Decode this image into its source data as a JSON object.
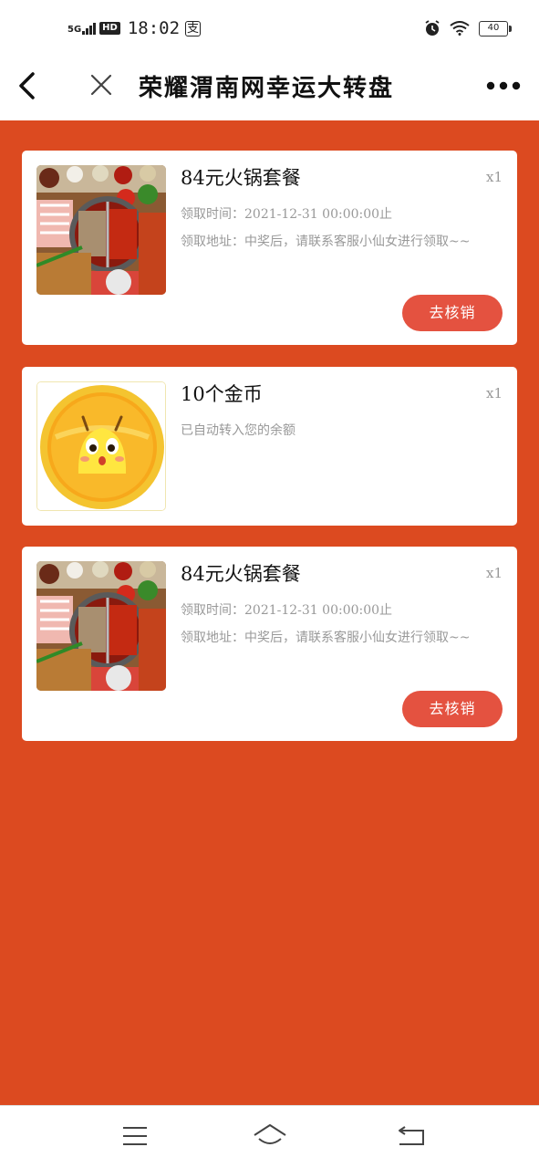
{
  "status_bar": {
    "network": "5G",
    "hd": "HD",
    "time": "18:02",
    "pay_badge": "支",
    "battery": "40"
  },
  "nav": {
    "title": "荣耀渭南网幸运大转盘",
    "back_icon": "chevron-left-icon",
    "close_icon": "close-icon",
    "more_icon": "more-dots-icon"
  },
  "prizes": [
    {
      "title": "84元火锅套餐",
      "qty": "x1",
      "time_line": "领取时间：2021-12-31 00:00:00止",
      "address_line": "领取地址：中奖后，请联系客服小仙女进行领取~~",
      "button": "去核销",
      "image": "hotpot-photo"
    },
    {
      "title": "10个金币",
      "qty": "x1",
      "note": "已自动转入您的余额",
      "image": "gold-coin-mascot"
    },
    {
      "title": "84元火锅套餐",
      "qty": "x1",
      "time_line": "领取时间：2021-12-31 00:00:00止",
      "address_line": "领取地址：中奖后，请联系客服小仙女进行领取~~",
      "button": "去核销",
      "image": "hotpot-photo"
    }
  ],
  "colors": {
    "background": "#dc4a20",
    "button": "#e45240",
    "card": "#ffffff"
  },
  "bottom_bar": {
    "menu_icon": "menu-icon",
    "home_icon": "home-icon",
    "back_icon": "return-icon"
  }
}
